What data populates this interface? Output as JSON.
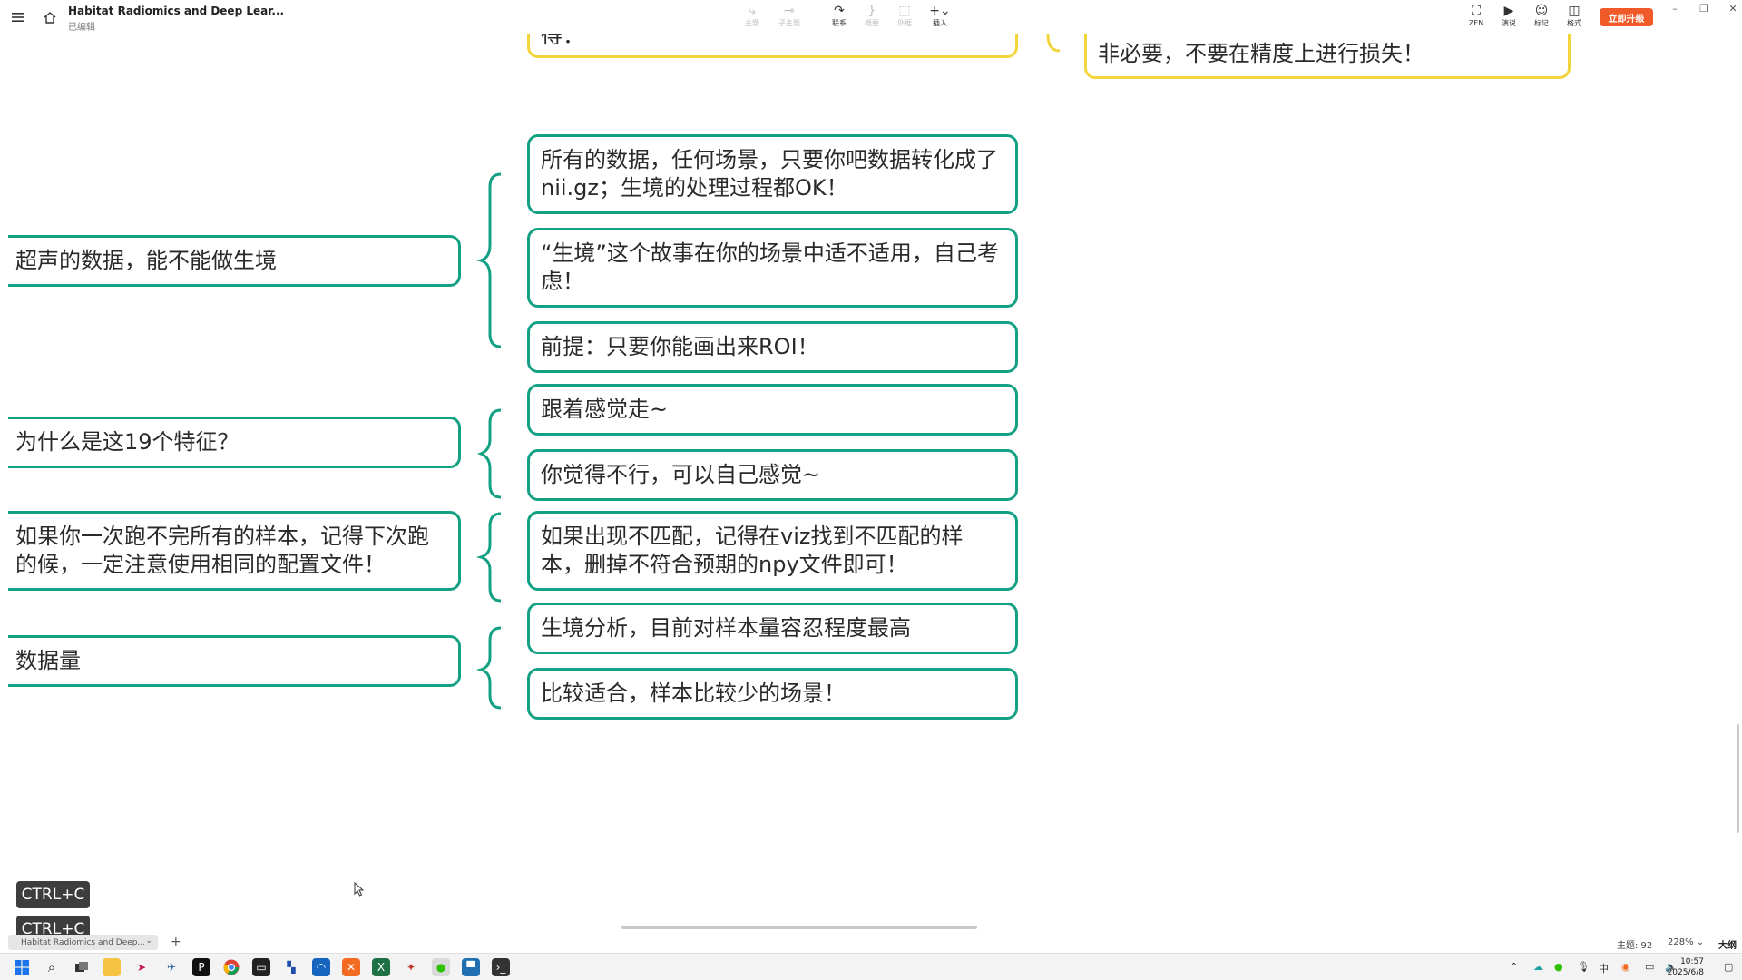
{
  "titlebar": {
    "doc_title": "Habitat Radiomics and Deep Lear...",
    "doc_status": "已编辑",
    "tools": [
      {
        "icon": "topic-icon",
        "label": "主题",
        "enabled": false
      },
      {
        "icon": "subtopic-icon",
        "label": "子主题",
        "enabled": false
      },
      {
        "icon": "relation-icon",
        "label": "联系",
        "enabled": true
      },
      {
        "icon": "summary-icon",
        "label": "概要",
        "enabled": false
      },
      {
        "icon": "boundary-icon",
        "label": "外框",
        "enabled": false
      },
      {
        "icon": "insert-icon",
        "label": "插入",
        "enabled": true
      }
    ],
    "right_tools": [
      {
        "icon": "zen-icon",
        "label": "ZEN"
      },
      {
        "icon": "present-icon",
        "label": "演说"
      },
      {
        "icon": "marker-icon",
        "label": "标记"
      },
      {
        "icon": "format-icon",
        "label": "格式"
      }
    ],
    "upgrade_label": "立即升级"
  },
  "mindmap": {
    "top_left_partial": "得：",
    "top_right_partial": "非必要，不要在精度上进行损失！",
    "branches": [
      {
        "topic": "超声的数据，能不能做生境",
        "children": [
          "所有的数据，任何场景，只要你吧数据转化成了nii.gz；生境的处理过程都OK！",
          "“生境”这个故事在你的场景中适不适用，自己考虑！",
          "前提：只要你能画出来ROI！"
        ]
      },
      {
        "topic": "为什么是这19个特征？",
        "children": [
          "跟着感觉走~",
          "你觉得不行，可以自己感觉~"
        ]
      },
      {
        "topic": "如果你一次跑不完所有的样本，记得下次跑的候，一定注意使用相同的配置文件！",
        "children": [
          "如果出现不匹配，记得在viz找到不匹配的样本，删掉不符合预期的npy文件即可！"
        ]
      },
      {
        "topic": "数据量",
        "children": [
          "生境分析，目前对样本量容忍程度最高",
          "比较适合，样本比较少的场景！"
        ]
      }
    ]
  },
  "key_hints": [
    "CTRL+C",
    "CTRL+C"
  ],
  "statusbar": {
    "sheet_tab": "Habitat Radiomics and Deep...",
    "topic_count": "主题: 92",
    "zoom": "228%",
    "outline_label": "大纲"
  },
  "taskbar": {
    "apps": [
      "start-icon",
      "search-icon",
      "taskview-icon",
      "explorer-icon",
      "feishu-icon",
      "paper-plane-icon",
      "pycharm-icon",
      "chrome-icon",
      "terminal-icon",
      "files-icon",
      "app-icon",
      "xmind-icon",
      "excel-icon",
      "bird-icon",
      "wechat-icon",
      "remote-desktop-icon",
      "cmd-icon"
    ],
    "time": "10:57",
    "date": "2025/6/8"
  },
  "colors": {
    "node_border": "#13a083",
    "yellow_border": "#f2d53c",
    "upgrade": "#f05a28"
  }
}
